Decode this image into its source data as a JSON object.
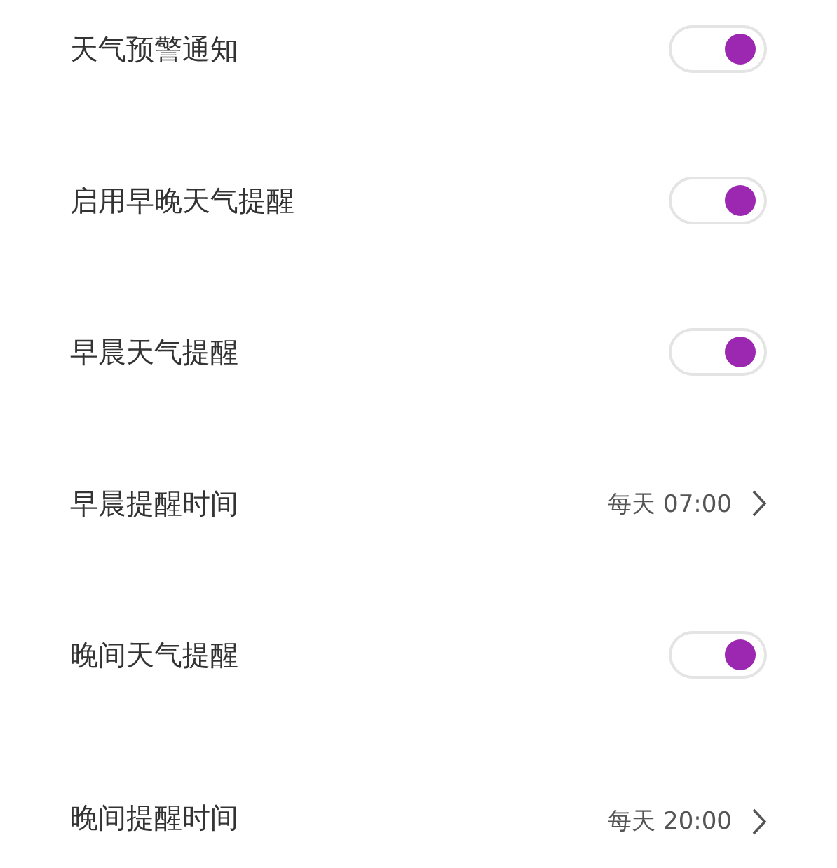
{
  "settings": [
    {
      "kind": "toggle",
      "label": "天气预警通知",
      "on": true
    },
    {
      "kind": "toggle",
      "label": "启用早晚天气提醒",
      "on": true
    },
    {
      "kind": "toggle",
      "label": "早晨天气提醒",
      "on": true
    },
    {
      "kind": "link",
      "label": "早晨提醒时间",
      "value": "每天 07:00"
    },
    {
      "kind": "toggle",
      "label": "晚间天气提醒",
      "on": true
    },
    {
      "kind": "link",
      "label": "晚间提醒时间",
      "value": "每天 20:00"
    }
  ]
}
